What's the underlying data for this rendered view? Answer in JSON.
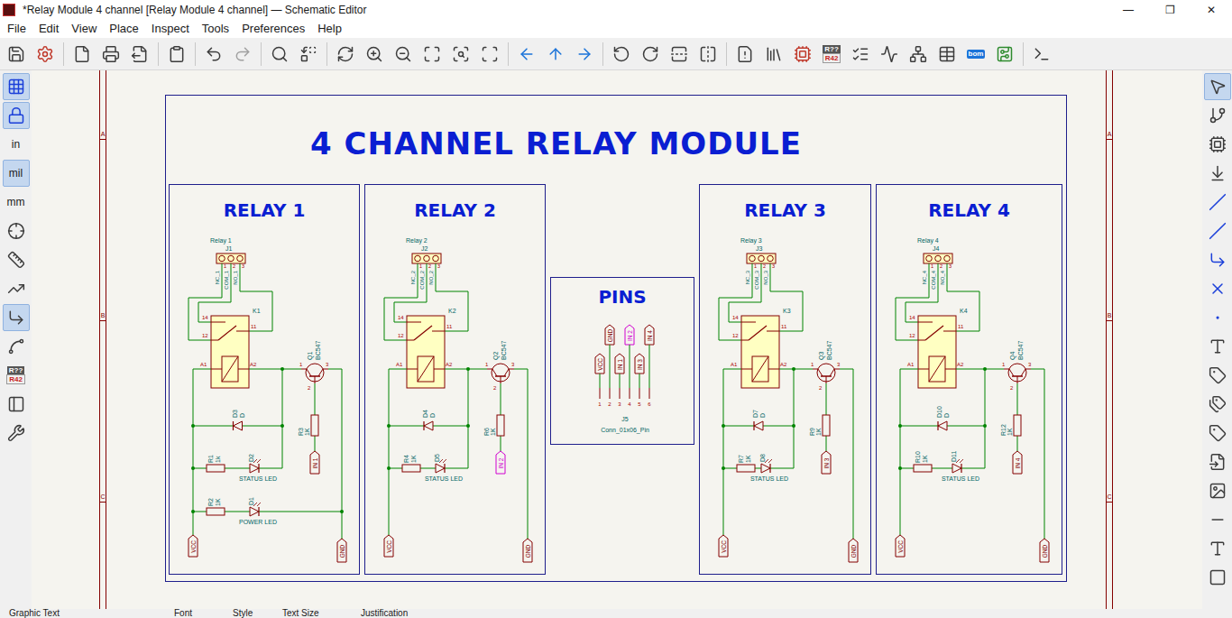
{
  "window": {
    "title": "*Relay Module 4 channel [Relay Module 4 channel] — Schematic Editor",
    "controls": [
      "—",
      "❐",
      "✕"
    ]
  },
  "menu": [
    "File",
    "Edit",
    "View",
    "Place",
    "Inspect",
    "Tools",
    "Preferences",
    "Help"
  ],
  "toolbar": {
    "annotate": [
      "R??",
      "R42"
    ],
    "bom": "bom"
  },
  "left_toolbar": [
    {
      "kind": "grid",
      "selected": true
    },
    {
      "kind": "lock",
      "selected": true
    },
    {
      "kind": "unit",
      "label": "in",
      "selected": false
    },
    {
      "kind": "unit",
      "label": "mil",
      "selected": true
    },
    {
      "kind": "unit",
      "label": "mm",
      "selected": false
    },
    {
      "kind": "cursor",
      "selected": false
    },
    {
      "kind": "pins",
      "selected": false
    },
    {
      "kind": "line-free",
      "selected": false
    },
    {
      "kind": "line-90",
      "selected": true
    },
    {
      "kind": "line-45",
      "selected": false
    },
    {
      "kind": "annotate",
      "labels": [
        "R??",
        "R42"
      ],
      "selected": false
    },
    {
      "kind": "panel",
      "selected": false
    },
    {
      "kind": "wrench",
      "selected": false
    }
  ],
  "right_toolbar": [
    {
      "kind": "select",
      "selected": true
    },
    {
      "kind": "hierarchy",
      "selected": false
    },
    {
      "kind": "symbol",
      "selected": false
    },
    {
      "kind": "power",
      "selected": false
    },
    {
      "kind": "wire",
      "selected": false
    },
    {
      "kind": "bus",
      "selected": false
    },
    {
      "kind": "bus-entry",
      "selected": false
    },
    {
      "kind": "no-connect",
      "selected": false
    },
    {
      "kind": "junction",
      "selected": false
    },
    {
      "kind": "label",
      "selected": false
    },
    {
      "kind": "net-class",
      "selected": false
    },
    {
      "kind": "global-label",
      "selected": false
    },
    {
      "kind": "hier-label",
      "selected": false
    },
    {
      "kind": "sheet",
      "selected": false
    },
    {
      "kind": "image",
      "selected": false
    },
    {
      "kind": "line",
      "selected": false
    },
    {
      "kind": "text",
      "selected": false
    },
    {
      "kind": "rectangle",
      "selected": false
    }
  ],
  "sheet": {
    "rows": [
      "A",
      "B",
      "C"
    ],
    "title": "4 CHANNEL RELAY MODULE"
  },
  "relays": [
    {
      "title": "RELAY 1",
      "connector": {
        "name": "Relay 1",
        "ref": "J1",
        "pins": [
          {
            "name": "NC_1",
            "number": "1"
          },
          {
            "name": "COM_1",
            "number": "2"
          },
          {
            "name": "NO_1",
            "number": "3"
          }
        ]
      },
      "relay": {
        "ref": "K1",
        "pins": [
          "14",
          "12",
          "11",
          "A1",
          "A2"
        ]
      },
      "transistor": {
        "ref": "Q1",
        "value": "BC547",
        "pins": [
          "1",
          "2",
          "3"
        ]
      },
      "flyback": {
        "ref": "D3",
        "value": "D"
      },
      "status": {
        "resistor_ref": "R1",
        "resistor_value": "1k",
        "led_ref": "D2",
        "label": "STATUS LED"
      },
      "base_resistor": {
        "ref": "R3",
        "value": "1K"
      },
      "power": {
        "resistor_ref": "R2",
        "resistor_value": "1K",
        "led_ref": "D1",
        "label": "POWER LED"
      },
      "vcc": "VCC",
      "gnd": "GND",
      "input": {
        "label": "IN 1",
        "highlighted": false
      }
    },
    {
      "title": "RELAY 2",
      "connector": {
        "name": "Relay 2",
        "ref": "J2",
        "pins": [
          {
            "name": "NC_2",
            "number": "1"
          },
          {
            "name": "COM_2",
            "number": "2"
          },
          {
            "name": "NO_2",
            "number": "3"
          }
        ]
      },
      "relay": {
        "ref": "K2",
        "pins": [
          "14",
          "12",
          "11",
          "A1",
          "A2"
        ]
      },
      "transistor": {
        "ref": "Q2",
        "value": "BC547",
        "pins": [
          "1",
          "2",
          "3"
        ]
      },
      "flyback": {
        "ref": "D4",
        "value": "D"
      },
      "status": {
        "resistor_ref": "R4",
        "resistor_value": "1K",
        "led_ref": "D5",
        "label": "STATUS LED"
      },
      "base_resistor": {
        "ref": "R6",
        "value": "1K"
      },
      "vcc": "VCC",
      "gnd": "GND",
      "input": {
        "label": "IN 2",
        "highlighted": true
      }
    },
    {
      "title": "RELAY 3",
      "connector": {
        "name": "Relay 3",
        "ref": "J3",
        "pins": [
          {
            "name": "NC_3",
            "number": "1"
          },
          {
            "name": "COM_3",
            "number": "2"
          },
          {
            "name": "NO_3",
            "number": "3"
          }
        ]
      },
      "relay": {
        "ref": "K3",
        "pins": [
          "14",
          "12",
          "11",
          "A1",
          "A2"
        ]
      },
      "transistor": {
        "ref": "Q3",
        "value": "BC547",
        "pins": [
          "1",
          "2",
          "3"
        ]
      },
      "flyback": {
        "ref": "D7",
        "value": "D"
      },
      "status": {
        "resistor_ref": "R7",
        "resistor_value": "1K",
        "led_ref": "D8",
        "label": "STATUS LED"
      },
      "base_resistor": {
        "ref": "R9",
        "value": "1K"
      },
      "vcc": "VCC",
      "gnd": "GND",
      "input": {
        "label": "IN 3",
        "highlighted": false
      }
    },
    {
      "title": "RELAY 4",
      "connector": {
        "name": "Relay 4",
        "ref": "J4",
        "pins": [
          {
            "name": "NC_4",
            "number": "1"
          },
          {
            "name": "COM_4",
            "number": "2"
          },
          {
            "name": "NO_4",
            "number": "3"
          }
        ]
      },
      "relay": {
        "ref": "K4",
        "pins": [
          "14",
          "12",
          "11",
          "A1",
          "A2"
        ]
      },
      "transistor": {
        "ref": "Q4",
        "value": "BC547",
        "pins": [
          "1",
          "2",
          "3"
        ]
      },
      "flyback": {
        "ref": "D10",
        "value": "D"
      },
      "status": {
        "resistor_ref": "R10",
        "resistor_value": "1K",
        "led_ref": "D11",
        "label": "STATUS LED"
      },
      "base_resistor": {
        "ref": "R12",
        "value": "1K"
      },
      "vcc": "VCC",
      "gnd": "GND",
      "input": {
        "label": "IN 4",
        "highlighted": false
      }
    }
  ],
  "pins": {
    "title": "PINS",
    "ref": "J5",
    "value": "Conn_01x06_Pin",
    "pins": [
      {
        "label": "VCC",
        "number": "1",
        "highlighted": false
      },
      {
        "label": "GND",
        "number": "2",
        "highlighted": false
      },
      {
        "label": "IN 1",
        "number": "3",
        "highlighted": false
      },
      {
        "label": "IN 2",
        "number": "4",
        "highlighted": true
      },
      {
        "label": "IN 3",
        "number": "5",
        "highlighted": false
      },
      {
        "label": "IN 4",
        "number": "6",
        "highlighted": false
      }
    ]
  },
  "properties_bar": [
    "Graphic Text",
    "Font",
    "Style",
    "Text Size",
    "Justification"
  ]
}
